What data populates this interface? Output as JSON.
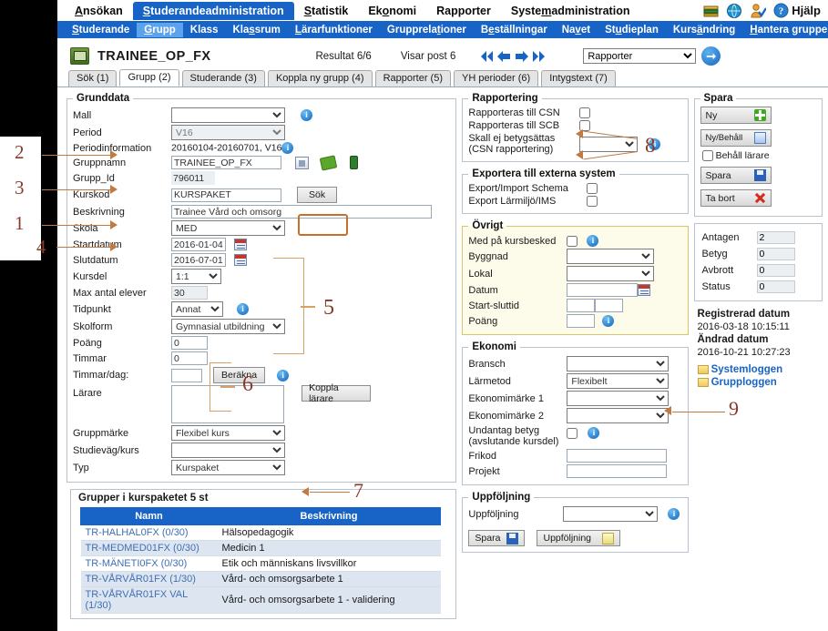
{
  "menu": {
    "items": [
      {
        "label": "Ansökan",
        "active": false
      },
      {
        "label": "Studerandeadministration",
        "active": true
      },
      {
        "label": "Statistik",
        "active": false
      },
      {
        "label": "Ekonomi",
        "active": false
      },
      {
        "label": "Rapporter",
        "active": false
      },
      {
        "label": "Systemadministration",
        "active": false
      }
    ],
    "help_label": "Hjälp",
    "icons": [
      "books-icon",
      "globe-icon",
      "user-check-icon",
      "help-circle-icon"
    ]
  },
  "submenu": {
    "items": [
      {
        "label": "Studerande",
        "active": false
      },
      {
        "label": "Grupp",
        "active": true
      },
      {
        "label": "Klass",
        "active": false
      },
      {
        "label": "Klassrum",
        "active": false
      },
      {
        "label": "Lärarfunktioner",
        "active": false
      },
      {
        "label": "Grupprelationer",
        "active": false
      },
      {
        "label": "Beställningar",
        "active": false
      },
      {
        "label": "Navet",
        "active": false
      },
      {
        "label": "Studieplan",
        "active": false
      },
      {
        "label": "Kursändring",
        "active": false
      },
      {
        "label": "Hantera grupper",
        "active": false
      }
    ]
  },
  "titlebar": {
    "title": "TRAINEE_OP_FX",
    "result": "Resultat 6/6",
    "post": "Visar post 6",
    "report_select": "Rapporter",
    "go_label": "→"
  },
  "tabs": [
    {
      "label": "Sök (1)",
      "active": false
    },
    {
      "label": "Grupp (2)",
      "active": true
    },
    {
      "label": "Studerande (3)",
      "active": false
    },
    {
      "label": "Koppla ny grupp (4)",
      "active": false
    },
    {
      "label": "Rapporter (5)",
      "active": false
    },
    {
      "label": "YH perioder (6)",
      "active": false
    },
    {
      "label": "Intygstext (7)",
      "active": false
    }
  ],
  "grunddata": {
    "legend": "Grunddata",
    "mall_label": "Mall",
    "mall_value": "",
    "period_label": "Period",
    "period_value": "V16",
    "periodinfo_label": "Periodinformation",
    "periodinfo_value": "20160104-20160701, V16",
    "gruppnamn_label": "Gruppnamn",
    "gruppnamn_value": "TRAINEE_OP_FX",
    "gruppid_label": "Grupp_Id",
    "gruppid_value": "796011",
    "kurskod_label": "Kurskod",
    "kurskod_value": "KURSPAKET",
    "sok_button": "Sök",
    "beskrivning_label": "Beskrivning",
    "beskrivning_value": "Trainee Vård och omsorg",
    "skola_label": "Skola",
    "skola_value": "MED",
    "startdatum_label": "Startdatum",
    "startdatum_value": "2016-01-04",
    "slutdatum_label": "Slutdatum",
    "slutdatum_value": "2016-07-01",
    "kursdel_label": "Kursdel",
    "kursdel_value": "1:1",
    "maxelever_label": "Max antal elever",
    "maxelever_value": "30",
    "tidpunkt_label": "Tidpunkt",
    "tidpunkt_value": "Annat",
    "skolform_label": "Skolform",
    "skolform_value": "Gymnasial utbildning",
    "poang_label": "Poäng",
    "poang_value": "0",
    "timmar_label": "Timmar",
    "timmar_value": "0",
    "timmardag_label": "Timmar/dag:",
    "timmardag_value": "",
    "berakna_button": "Beräkna",
    "larare_label": "Lärare",
    "larare_value": "",
    "koppla_larare_button": "Koppla lärare",
    "gruppmarke_label": "Gruppmärke",
    "gruppmarke_value": "Flexibel kurs",
    "studievag_label": "Studieväg/kurs",
    "studievag_value": "",
    "typ_label": "Typ",
    "typ_value": "Kurspaket"
  },
  "grupper_table": {
    "legend": "Grupper i kurspaketet 5 st",
    "columns": [
      "Namn",
      "Beskrivning"
    ],
    "rows": [
      [
        "TR-HALHAL0FX (0/30)",
        "Hälsopedagogik"
      ],
      [
        "TR-MEDMED01FX (0/30)",
        "Medicin 1"
      ],
      [
        "TR-MÄNETI0FX (0/30)",
        "Etik och människans livsvillkor"
      ],
      [
        "TR-VÅRVÅR01FX (1/30)",
        "Vård- och omsorgsarbete 1"
      ],
      [
        "TR-VÅRVÅR01FX VAL (1/30)",
        "Vård- och omsorgsarbete 1 - validering"
      ]
    ]
  },
  "rapportering": {
    "legend": "Rapportering",
    "csn_label": "Rapporteras till CSN",
    "csn_checked": false,
    "scb_label": "Rapporteras till SCB",
    "scb_checked": false,
    "betyg_label": "Skall ej betygsättas (CSN rapportering)",
    "betyg_value": ""
  },
  "exportera": {
    "legend": "Exportera till externa system",
    "schema_label": "Export/Import Schema",
    "schema_checked": false,
    "larmiljo_label": "Export Lärmiljö/IMS",
    "larmiljo_checked": false
  },
  "ovrigt": {
    "legend": "Övrigt",
    "kursbesked_label": "Med på kursbesked",
    "kursbesked_checked": false,
    "byggnad_label": "Byggnad",
    "byggnad_value": "",
    "lokal_label": "Lokal",
    "lokal_value": "",
    "datum_label": "Datum",
    "datum_value": "",
    "starttid_label": "Start-sluttid",
    "starttid_value": "",
    "sluttid_value": "",
    "poang_label": "Poäng",
    "poang_value": ""
  },
  "ekonomi": {
    "legend": "Ekonomi",
    "bransch_label": "Bransch",
    "bransch_value": "",
    "larmetod_label": "Lärmetod",
    "larmetod_value": "Flexibelt",
    "ekmarke1_label": "Ekonomimärke 1",
    "ekmarke1_value": "",
    "ekmarke2_label": "Ekonomimärke 2",
    "ekmarke2_value": "",
    "undantag_label": "Undantag betyg (avslutande kursdel)",
    "undantag_checked": false,
    "frikod_label": "Frikod",
    "frikod_value": "",
    "projekt_label": "Projekt",
    "projekt_value": ""
  },
  "uppfoljning": {
    "legend": "Uppföljning",
    "field_label": "Uppföljning",
    "field_value": "",
    "spara_button": "Spara",
    "uppfoljning_button": "Uppföljning"
  },
  "spara_panel": {
    "legend": "Spara",
    "ny_button": "Ny",
    "nybehall_button": "Ny/Behåll",
    "behall_larare_label": "Behåll lärare",
    "behall_larare_checked": false,
    "spara_button": "Spara",
    "tabort_button": "Ta bort"
  },
  "stats": {
    "rows": [
      {
        "label": "Antagen",
        "value": "2"
      },
      {
        "label": "Betyg",
        "value": "0"
      },
      {
        "label": "Avbrott",
        "value": "0"
      },
      {
        "label": "Status",
        "value": "0"
      }
    ]
  },
  "dates": {
    "registrerad_label": "Registrerad datum",
    "registrerad_value": "2016-03-18 10:15:11",
    "andrad_label": "Ändrad datum",
    "andrad_value": "2016-10-21 10:27:23",
    "systemloggen_link": "Systemloggen",
    "grupploggen_link": "Grupploggen"
  },
  "annotations": [
    {
      "id": "1",
      "number": "1",
      "target": "Kurskod"
    },
    {
      "id": "2",
      "number": "2",
      "target": "Period"
    },
    {
      "id": "3",
      "number": "3",
      "target": "Gruppnamn"
    },
    {
      "id": "4",
      "number": "4",
      "target": "Beskrivning"
    },
    {
      "id": "5",
      "number": "5",
      "target": "Skola..Skolform"
    },
    {
      "id": "6",
      "number": "6",
      "target": "Poäng/Timmar"
    },
    {
      "id": "7",
      "number": "7",
      "target": "Studieväg/kurs"
    },
    {
      "id": "8",
      "number": "8",
      "target": "Rapporteras till CSN/SCB"
    },
    {
      "id": "9",
      "number": "9",
      "target": "Lärmetod"
    }
  ],
  "colors": {
    "brand_blue": "#1763c6",
    "tab_active_bg": "#ffffff",
    "annot": "#8a3a2a",
    "highlight": "#c8702a"
  }
}
